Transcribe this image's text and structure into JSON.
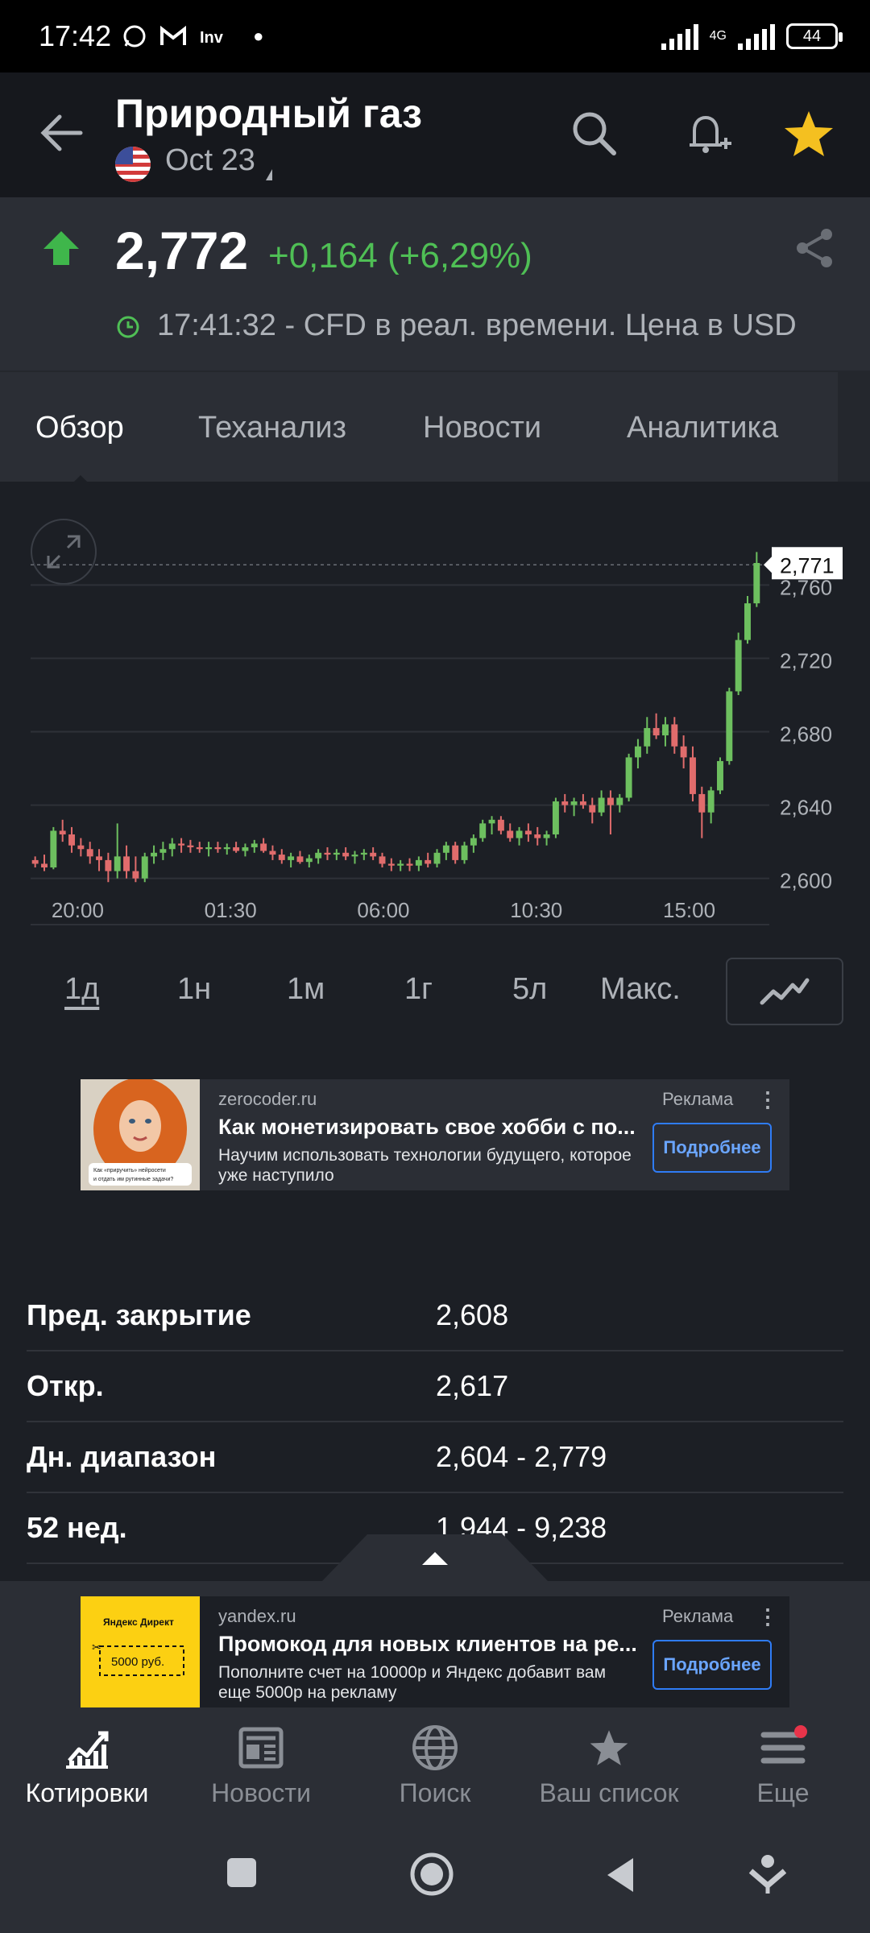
{
  "status_bar": {
    "time": "17:42",
    "net": "4G",
    "battery": "44",
    "notif_icons": [
      "whatsapp-icon",
      "gmail-icon",
      "investing-icon"
    ]
  },
  "header": {
    "title": "Природный газ",
    "contract": "Oct 23"
  },
  "quote": {
    "price": "2,772",
    "change": "+0,164 (+6,29%)",
    "realtime_note": "17:41:32 - CFD в реал. времени. Цена в USD",
    "change_color": "#4fbf55"
  },
  "tabs": [
    {
      "label": "Обзор",
      "active": true
    },
    {
      "label": "Теханализ",
      "active": false
    },
    {
      "label": "Новости",
      "active": false
    },
    {
      "label": "Аналитика",
      "active": false
    }
  ],
  "chart_data": {
    "type": "candlestick",
    "x_ticks": [
      "20:00",
      "01:30",
      "06:00",
      "10:30",
      "15:00"
    ],
    "y_ticks": [
      "2,600",
      "2,640",
      "2,680",
      "2,720",
      "2,760"
    ],
    "ylim": [
      2.588,
      2.79
    ],
    "last_price_label": "2,771",
    "last_price": 2.771,
    "up_color": "#6dbf5f",
    "down_color": "#e06c6c",
    "candles": [
      [
        2.61,
        2.612,
        2.606,
        2.608
      ],
      [
        2.608,
        2.613,
        2.604,
        2.606
      ],
      [
        2.606,
        2.628,
        2.605,
        2.626
      ],
      [
        2.626,
        2.632,
        2.62,
        2.624
      ],
      [
        2.624,
        2.628,
        2.614,
        2.618
      ],
      [
        2.618,
        2.622,
        2.612,
        2.616
      ],
      [
        2.616,
        2.62,
        2.608,
        2.612
      ],
      [
        2.612,
        2.616,
        2.604,
        2.61
      ],
      [
        2.61,
        2.614,
        2.598,
        2.604
      ],
      [
        2.604,
        2.63,
        2.6,
        2.612
      ],
      [
        2.612,
        2.618,
        2.6,
        2.604
      ],
      [
        2.604,
        2.612,
        2.598,
        2.6
      ],
      [
        2.6,
        2.614,
        2.598,
        2.612
      ],
      [
        2.612,
        2.618,
        2.608,
        2.614
      ],
      [
        2.614,
        2.62,
        2.61,
        2.616
      ],
      [
        2.616,
        2.622,
        2.612,
        2.619
      ],
      [
        2.619,
        2.622,
        2.614,
        2.618
      ],
      [
        2.618,
        2.621,
        2.614,
        2.617
      ],
      [
        2.617,
        2.62,
        2.614,
        2.616
      ],
      [
        2.616,
        2.62,
        2.612,
        2.617
      ],
      [
        2.617,
        2.62,
        2.614,
        2.616
      ],
      [
        2.616,
        2.619,
        2.613,
        2.617
      ],
      [
        2.617,
        2.62,
        2.614,
        2.615
      ],
      [
        2.615,
        2.619,
        2.612,
        2.617
      ],
      [
        2.617,
        2.621,
        2.614,
        2.619
      ],
      [
        2.619,
        2.622,
        2.614,
        2.615
      ],
      [
        2.615,
        2.618,
        2.61,
        2.613
      ],
      [
        2.613,
        2.616,
        2.608,
        2.61
      ],
      [
        2.61,
        2.614,
        2.606,
        2.612
      ],
      [
        2.612,
        2.615,
        2.608,
        2.609
      ],
      [
        2.609,
        2.613,
        2.606,
        2.611
      ],
      [
        2.611,
        2.616,
        2.608,
        2.614
      ],
      [
        2.614,
        2.617,
        2.61,
        2.613
      ],
      [
        2.613,
        2.616,
        2.61,
        2.614
      ],
      [
        2.614,
        2.617,
        2.61,
        2.612
      ],
      [
        2.612,
        2.615,
        2.608,
        2.613
      ],
      [
        2.613,
        2.616,
        2.61,
        2.614
      ],
      [
        2.614,
        2.617,
        2.61,
        2.612
      ],
      [
        2.612,
        2.614,
        2.606,
        2.608
      ],
      [
        2.608,
        2.611,
        2.604,
        2.607
      ],
      [
        2.607,
        2.61,
        2.604,
        2.608
      ],
      [
        2.608,
        2.611,
        2.604,
        2.607
      ],
      [
        2.607,
        2.612,
        2.604,
        2.61
      ],
      [
        2.61,
        2.614,
        2.606,
        2.608
      ],
      [
        2.608,
        2.616,
        2.606,
        2.614
      ],
      [
        2.614,
        2.62,
        2.61,
        2.618
      ],
      [
        2.618,
        2.62,
        2.608,
        2.61
      ],
      [
        2.61,
        2.62,
        2.608,
        2.618
      ],
      [
        2.618,
        2.624,
        2.614,
        2.622
      ],
      [
        2.622,
        2.632,
        2.62,
        2.63
      ],
      [
        2.63,
        2.634,
        2.624,
        2.632
      ],
      [
        2.632,
        2.634,
        2.624,
        2.626
      ],
      [
        2.626,
        2.63,
        2.62,
        2.622
      ],
      [
        2.622,
        2.628,
        2.618,
        2.626
      ],
      [
        2.626,
        2.63,
        2.62,
        2.624
      ],
      [
        2.624,
        2.628,
        2.618,
        2.622
      ],
      [
        2.622,
        2.626,
        2.618,
        2.624
      ],
      [
        2.624,
        2.644,
        2.622,
        2.642
      ],
      [
        2.642,
        2.646,
        2.636,
        2.64
      ],
      [
        2.64,
        2.644,
        2.634,
        2.642
      ],
      [
        2.642,
        2.646,
        2.638,
        2.64
      ],
      [
        2.64,
        2.644,
        2.63,
        2.636
      ],
      [
        2.636,
        2.648,
        2.634,
        2.644
      ],
      [
        2.644,
        2.648,
        2.624,
        2.64
      ],
      [
        2.64,
        2.646,
        2.636,
        2.644
      ],
      [
        2.644,
        2.668,
        2.642,
        2.666
      ],
      [
        2.666,
        2.676,
        2.66,
        2.672
      ],
      [
        2.672,
        2.688,
        2.668,
        2.682
      ],
      [
        2.682,
        2.69,
        2.676,
        2.678
      ],
      [
        2.678,
        2.688,
        2.672,
        2.684
      ],
      [
        2.684,
        2.688,
        2.668,
        2.672
      ],
      [
        2.672,
        2.678,
        2.66,
        2.666
      ],
      [
        2.666,
        2.672,
        2.642,
        2.646
      ],
      [
        2.646,
        2.65,
        2.622,
        2.636
      ],
      [
        2.636,
        2.65,
        2.63,
        2.648
      ],
      [
        2.648,
        2.666,
        2.646,
        2.664
      ],
      [
        2.664,
        2.704,
        2.662,
        2.702
      ],
      [
        2.702,
        2.734,
        2.7,
        2.73
      ],
      [
        2.73,
        2.754,
        2.728,
        2.75
      ],
      [
        2.75,
        2.778,
        2.748,
        2.772
      ]
    ]
  },
  "periods": [
    {
      "label": "1д",
      "active": true
    },
    {
      "label": "1н",
      "active": false
    },
    {
      "label": "1м",
      "active": false
    },
    {
      "label": "1г",
      "active": false
    },
    {
      "label": "5л",
      "active": false
    },
    {
      "label": "Макс.",
      "active": false
    }
  ],
  "ad1": {
    "domain": "zerocoder.ru",
    "tag": "Реклама",
    "headline": "Как монетизировать свое хобби с по...",
    "body": "Научим использовать технологии будущего, которое уже наступило",
    "button": "Подробнее",
    "image_caption": "Как «приручить» нейросети и отдать им рутинные задачи?"
  },
  "stats": [
    {
      "label": "Пред. закрытие",
      "value": "2,608"
    },
    {
      "label": "Откр.",
      "value": "2,617"
    },
    {
      "label": "Дн. диапазон",
      "value": "2,604 - 2,779"
    },
    {
      "label": "52 нед.",
      "value": "1,944 - 9,238"
    }
  ],
  "ad2": {
    "domain": "yandex.ru",
    "tag": "Реклама",
    "headline": "Промокод для новых клиентов на ре...",
    "body": "Пополните счет на 10000р и Яндекс добавит вам еще 5000р на рекламу",
    "button": "Подробнее",
    "image_brand": "Яндекс Директ",
    "image_coupon": "5000 руб."
  },
  "bottom_nav": [
    {
      "label": "Котировки",
      "icon": "quotes-icon",
      "active": true
    },
    {
      "label": "Новости",
      "icon": "news-icon",
      "active": false
    },
    {
      "label": "Поиск",
      "icon": "globe-icon",
      "active": false
    },
    {
      "label": "Ваш список",
      "icon": "star-icon",
      "active": false
    },
    {
      "label": "Еще",
      "icon": "menu-icon",
      "active": false
    }
  ]
}
